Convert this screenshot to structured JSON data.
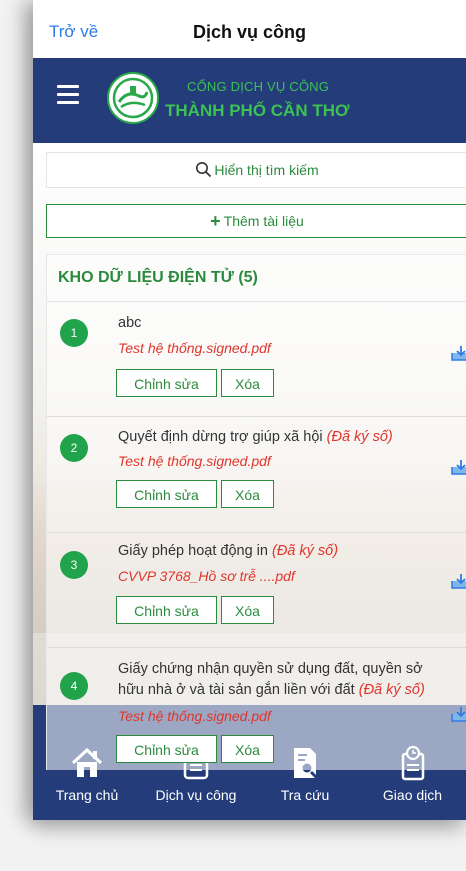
{
  "nav": {
    "back_label": "Trở về",
    "title": "Dịch vụ công"
  },
  "header": {
    "small_title": "CỔNG DỊCH VỤ CÔNG",
    "big_title": "THÀNH PHỐ CẦN THƠ",
    "brand_color": "#243d7a",
    "accent_color": "#3cc153"
  },
  "search": {
    "icon": "search-icon",
    "label": "Hiển thị tìm kiếm"
  },
  "add": {
    "icon": "plus-icon",
    "label": "Thêm tài liệu"
  },
  "panel": {
    "title": "KHO DỮ LIỆU ĐIỆN TỬ (5)"
  },
  "items": [
    {
      "number": "1",
      "name": "abc",
      "signed": "",
      "file": "Test hệ thống.signed.pdf"
    },
    {
      "number": "2",
      "name": "Quyết định dừng trợ giúp xã hội",
      "signed": "(Đã ký số)",
      "file": "Test hệ thống.signed.pdf"
    },
    {
      "number": "3",
      "name": "Giấy phép hoạt động in",
      "signed": "(Đã ký số)",
      "file": "CVVP 3768_Hồ sơ trễ ....pdf"
    },
    {
      "number": "4",
      "name_line1": "Giấy chứng nhận quyền sử dụng đất, quyền sở",
      "name_line2": "hữu nhà ở và tài sản gắn liền với đất",
      "signed": "(Đã ký số)",
      "file": "Test hệ thống.signed.pdf"
    }
  ],
  "buttons": {
    "edit": "Chỉnh sửa",
    "delete": "Xóa"
  },
  "tabs": [
    {
      "label": "Trang chủ",
      "icon": "home-icon"
    },
    {
      "label": "Dịch vụ công",
      "icon": "document-list-icon"
    },
    {
      "label": "Tra cứu",
      "icon": "search-document-icon"
    },
    {
      "label": "Giao dịch",
      "icon": "transaction-icon"
    }
  ]
}
